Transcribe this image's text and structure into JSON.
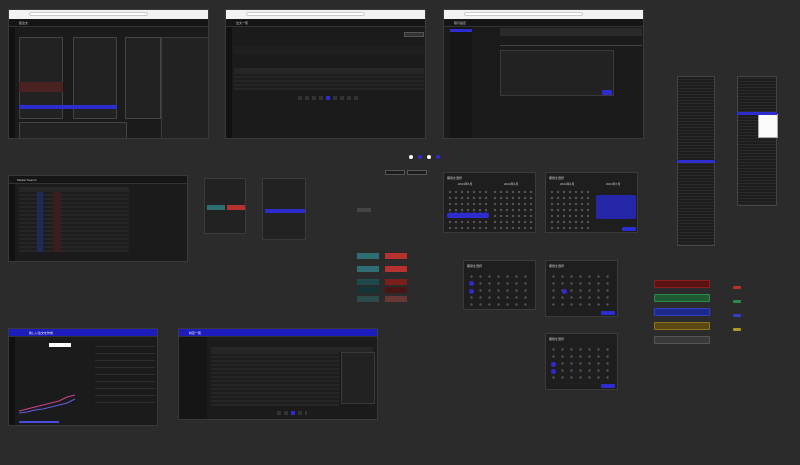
{
  "canvas": {
    "background": "#2b2b2b"
  },
  "colors": {
    "accent": "#2c2ccf",
    "teal": "#2e6e72",
    "red": "#b5322e",
    "dark": "#1b1b1b",
    "amber": "#6b5a1a",
    "green": "#1f5a33"
  },
  "frames": {
    "market_panel": {
      "title": "板注文"
    },
    "order_list": {
      "title": "注文一覧"
    },
    "settings": {
      "title": "取引設定"
    },
    "market_search": {
      "title": "Market Search"
    },
    "news": {
      "title": "新しい注文を作成"
    },
    "order_history": {
      "title": "約定一覧"
    }
  },
  "calendars": [
    {
      "title": "期間を選択",
      "left_month": "2024年5月",
      "right_month": "2024年6月"
    },
    {
      "title": "期間を選択",
      "left_month": "2024年6月",
      "right_month": "2024年7月"
    },
    {
      "title": "期間を選択"
    },
    {
      "title": "期間を選択"
    },
    {
      "title": "期間を選択"
    }
  ],
  "buttons": {
    "buy": "買",
    "sell": "売",
    "confirm": "確定",
    "cancel": "キャンセル"
  },
  "small_tags": [
    "ボタン",
    "ボタン"
  ],
  "pagination_dots": 4,
  "icons": [
    "menu-icon",
    "search-icon",
    "gear-icon",
    "user-icon",
    "bell-icon"
  ]
}
